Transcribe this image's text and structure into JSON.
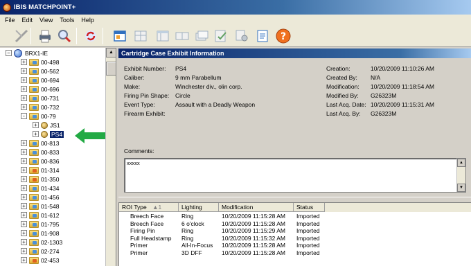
{
  "window": {
    "title": "IBIS MATCHPOINT+"
  },
  "menu": [
    "File",
    "Edit",
    "View",
    "Tools",
    "Help"
  ],
  "tree": {
    "root": "BRX1-IE",
    "items": [
      {
        "label": "00-498",
        "expander": "+",
        "icon": "blue"
      },
      {
        "label": "00-562",
        "expander": "+",
        "icon": "blue"
      },
      {
        "label": "00-694",
        "expander": "+",
        "icon": "blue"
      },
      {
        "label": "00-696",
        "expander": "+",
        "icon": "blue"
      },
      {
        "label": "00-731",
        "expander": "+",
        "icon": "blue"
      },
      {
        "label": "00-732",
        "expander": "+",
        "icon": "blue"
      },
      {
        "label": "00-79",
        "expander": "-",
        "icon": "blue"
      },
      {
        "label": "JS1",
        "expander": "+",
        "icon": "disc",
        "child": true
      },
      {
        "label": "PS4",
        "expander": "+",
        "icon": "disc",
        "child": true,
        "selected": true
      },
      {
        "label": "00-813",
        "expander": "+",
        "icon": "blue"
      },
      {
        "label": "00-833",
        "expander": "+",
        "icon": "blue"
      },
      {
        "label": "00-836",
        "expander": "+",
        "icon": "blue"
      },
      {
        "label": "01-314",
        "expander": "+",
        "icon": "orange"
      },
      {
        "label": "01-350",
        "expander": "+",
        "icon": "orange"
      },
      {
        "label": "01-434",
        "expander": "+",
        "icon": "blue"
      },
      {
        "label": "01-456",
        "expander": "+",
        "icon": "blue"
      },
      {
        "label": "01-548",
        "expander": "+",
        "icon": "blue"
      },
      {
        "label": "01-612",
        "expander": "+",
        "icon": "blue"
      },
      {
        "label": "01-795",
        "expander": "+",
        "icon": "blue"
      },
      {
        "label": "01-908",
        "expander": "+",
        "icon": "blue"
      },
      {
        "label": "02-1303",
        "expander": "+",
        "icon": "blue"
      },
      {
        "label": "02-274",
        "expander": "+",
        "icon": "blue"
      },
      {
        "label": "02-453",
        "expander": "+",
        "icon": "orange"
      }
    ]
  },
  "panel": {
    "title": "Cartridge Case Exhibit Information",
    "left": [
      {
        "label": "Exhibit Number:",
        "value": "PS4"
      },
      {
        "label": "Caliber:",
        "value": "9 mm Parabellum"
      },
      {
        "label": "Make:",
        "value": "Winchester div., olin corp."
      },
      {
        "label": "Firing Pin Shape:",
        "value": "Circle"
      },
      {
        "label": "Event Type:",
        "value": "Assault with a Deadly Weapon"
      },
      {
        "label": "Firearm Exhibit:",
        "value": ""
      }
    ],
    "right": [
      {
        "label": "Creation:",
        "value": "10/20/2009 11:10:26 AM"
      },
      {
        "label": "Created By:",
        "value": "N/A"
      },
      {
        "label": "Modification:",
        "value": "10/20/2009 11:18:54 AM"
      },
      {
        "label": "Modified By:",
        "value": "G26323M"
      },
      {
        "label": "Last Acq. Date:",
        "value": "10/20/2009 11:15:31 AM"
      },
      {
        "label": "Last Acq. By:",
        "value": "G26323M"
      }
    ],
    "comments_label": "Comments:",
    "comments_value": "xxxxx"
  },
  "grid": {
    "columns": [
      "ROI Type",
      "Lighting",
      "Modification",
      "Status"
    ],
    "sort_marker": "▲1",
    "rows": [
      [
        "Breech Face",
        "Ring",
        "10/20/2009 11:15:28 AM",
        "Imported"
      ],
      [
        "Breech Face",
        "6 o'clock",
        "10/20/2009 11:15:28 AM",
        "Imported"
      ],
      [
        "Firing Pin",
        "Ring",
        "10/20/2009 11:15:29 AM",
        "Imported"
      ],
      [
        "Full Headstamp",
        "Ring",
        "10/20/2009 11:15:32 AM",
        "Imported"
      ],
      [
        "Primer",
        "All-In-Focus",
        "10/20/2009 11:15:28 AM",
        "Imported"
      ],
      [
        "Primer",
        "3D DFF",
        "10/20/2009 11:15:28 AM",
        "Imported"
      ]
    ]
  },
  "colors": {
    "title_bar": "#0a246a",
    "arrow": "#22aa44",
    "selection": "#0a246a"
  }
}
